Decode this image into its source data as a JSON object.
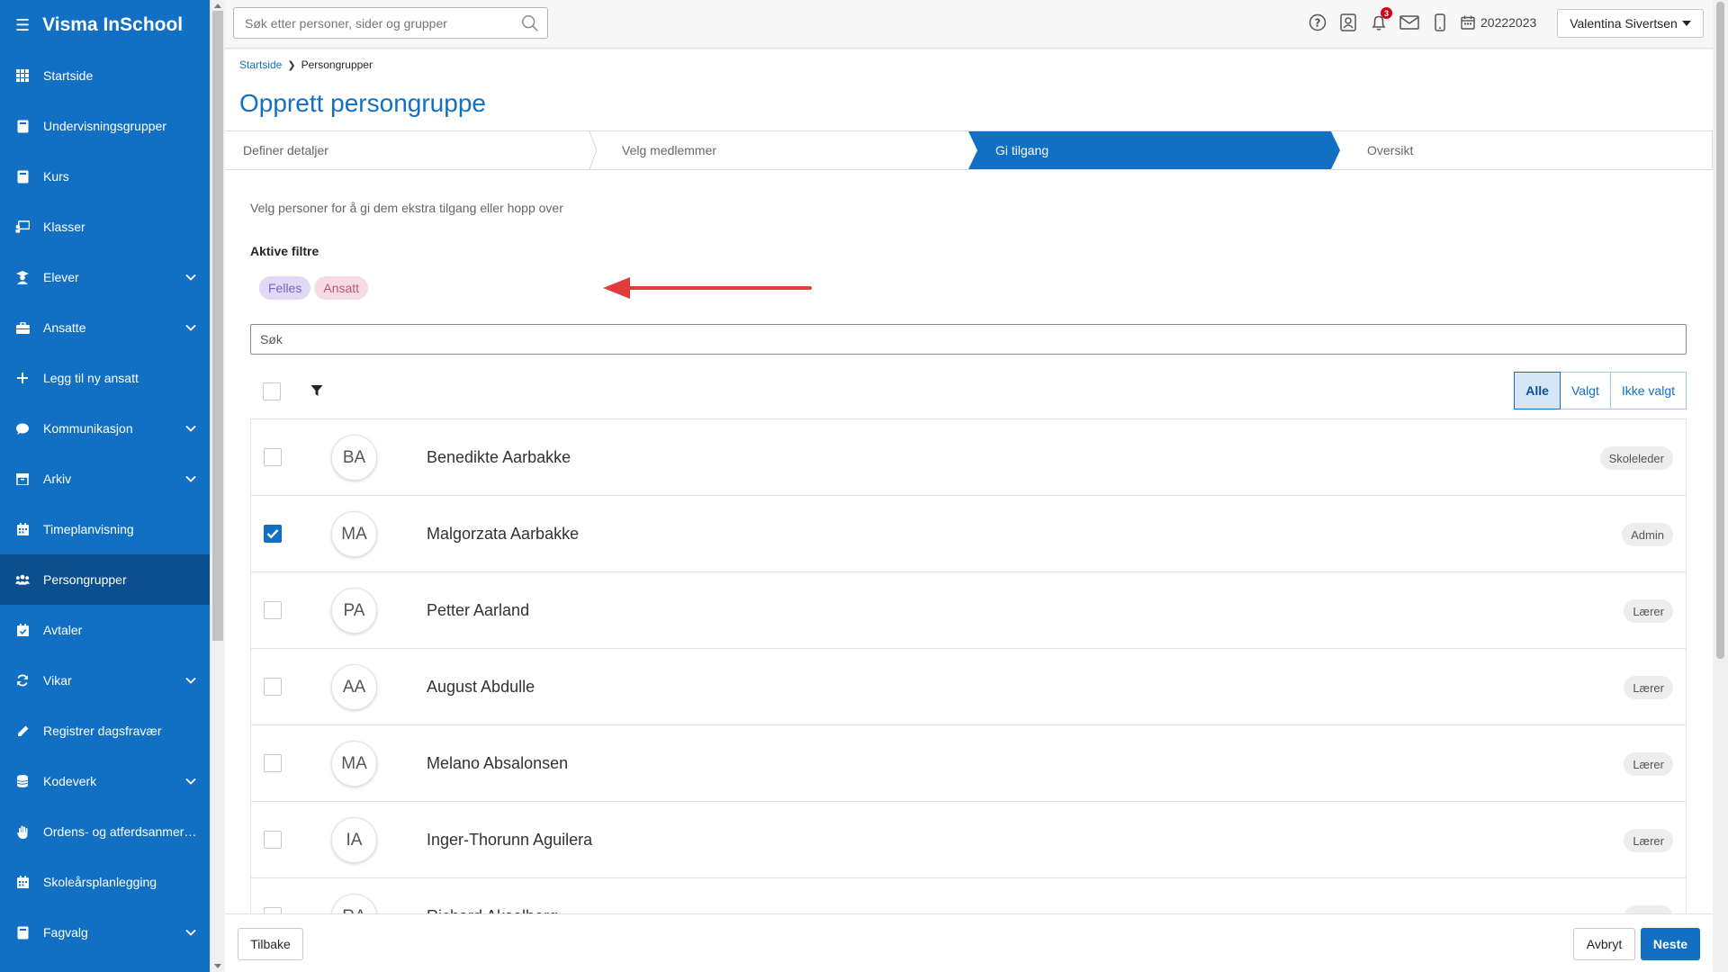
{
  "app": {
    "title": "Visma InSchool",
    "accent": "#1170c4",
    "active_nav": "#0b4f8e"
  },
  "sidebar": {
    "items": [
      {
        "label": "Startside",
        "icon": "grid-icon",
        "chevron": false,
        "active": false
      },
      {
        "label": "Undervisningsgrupper",
        "icon": "book-icon",
        "chevron": false,
        "active": false
      },
      {
        "label": "Kurs",
        "icon": "book-icon",
        "chevron": false,
        "active": false
      },
      {
        "label": "Klasser",
        "icon": "teacher-board-icon",
        "chevron": false,
        "active": false
      },
      {
        "label": "Elever",
        "icon": "student-icon",
        "chevron": true,
        "active": false
      },
      {
        "label": "Ansatte",
        "icon": "briefcase-icon",
        "chevron": true,
        "active": false
      },
      {
        "label": "Legg til ny ansatt",
        "icon": "plus-icon",
        "chevron": false,
        "active": false
      },
      {
        "label": "Kommunikasjon",
        "icon": "chat-icon",
        "chevron": true,
        "active": false
      },
      {
        "label": "Arkiv",
        "icon": "archive-icon",
        "chevron": true,
        "active": false
      },
      {
        "label": "Timeplanvisning",
        "icon": "calendar-icon",
        "chevron": false,
        "active": false
      },
      {
        "label": "Persongrupper",
        "icon": "users-icon",
        "chevron": false,
        "active": true
      },
      {
        "label": "Avtaler",
        "icon": "calendar-check-icon",
        "chevron": false,
        "active": false
      },
      {
        "label": "Vikar",
        "icon": "refresh-icon",
        "chevron": true,
        "active": false
      },
      {
        "label": "Registrer dagsfravær",
        "icon": "pencil-icon",
        "chevron": false,
        "active": false
      },
      {
        "label": "Kodeverk",
        "icon": "database-icon",
        "chevron": true,
        "active": false
      },
      {
        "label": "Ordens- og atferdsanmerk...",
        "icon": "hand-icon",
        "chevron": false,
        "active": false
      },
      {
        "label": "Skoleårsplanlegging",
        "icon": "calendar-icon",
        "chevron": false,
        "active": false
      },
      {
        "label": "Fagvalg",
        "icon": "book-icon",
        "chevron": true,
        "active": false
      }
    ]
  },
  "topbar": {
    "search_placeholder": "Søk etter personer, sider og grupper",
    "notifications_count": "3",
    "school_year": "20222023",
    "user_name": "Valentina Sivertsen"
  },
  "breadcrumb": {
    "home": "Startside",
    "current": "Persongrupper"
  },
  "page": {
    "title": "Opprett persongruppe",
    "steps": [
      {
        "label": "Definer detaljer",
        "active": false
      },
      {
        "label": "Velg medlemmer",
        "active": false
      },
      {
        "label": "Gi tilgang",
        "active": true
      },
      {
        "label": "Oversikt",
        "active": false
      }
    ],
    "helper_text": "Velg personer for å gi dem ekstra tilgang eller hopp over",
    "filters_label": "Aktive filtre",
    "filters": [
      "Felles",
      "Ansatt"
    ],
    "search_placeholder": "Søk",
    "segments": [
      {
        "label": "Alle",
        "active": true
      },
      {
        "label": "Valgt",
        "active": false
      },
      {
        "label": "Ikke valgt",
        "active": false
      }
    ],
    "people": [
      {
        "initials": "BA",
        "name": "Benedikte Aarbakke",
        "role": "Skoleleder",
        "checked": false
      },
      {
        "initials": "MA",
        "name": "Malgorzata Aarbakke",
        "role": "Admin",
        "checked": true
      },
      {
        "initials": "PA",
        "name": "Petter Aarland",
        "role": "Lærer",
        "checked": false
      },
      {
        "initials": "AA",
        "name": "August Abdulle",
        "role": "Lærer",
        "checked": false
      },
      {
        "initials": "MA",
        "name": "Melano Absalonsen",
        "role": "Lærer",
        "checked": false
      },
      {
        "initials": "IA",
        "name": "Inger-Thorunn Aguilera",
        "role": "Lærer",
        "checked": false
      },
      {
        "initials": "RA",
        "name": "Richard Akselberg",
        "role": "Lærer",
        "checked": false
      }
    ]
  },
  "footer": {
    "back": "Tilbake",
    "cancel": "Avbryt",
    "next": "Neste"
  }
}
